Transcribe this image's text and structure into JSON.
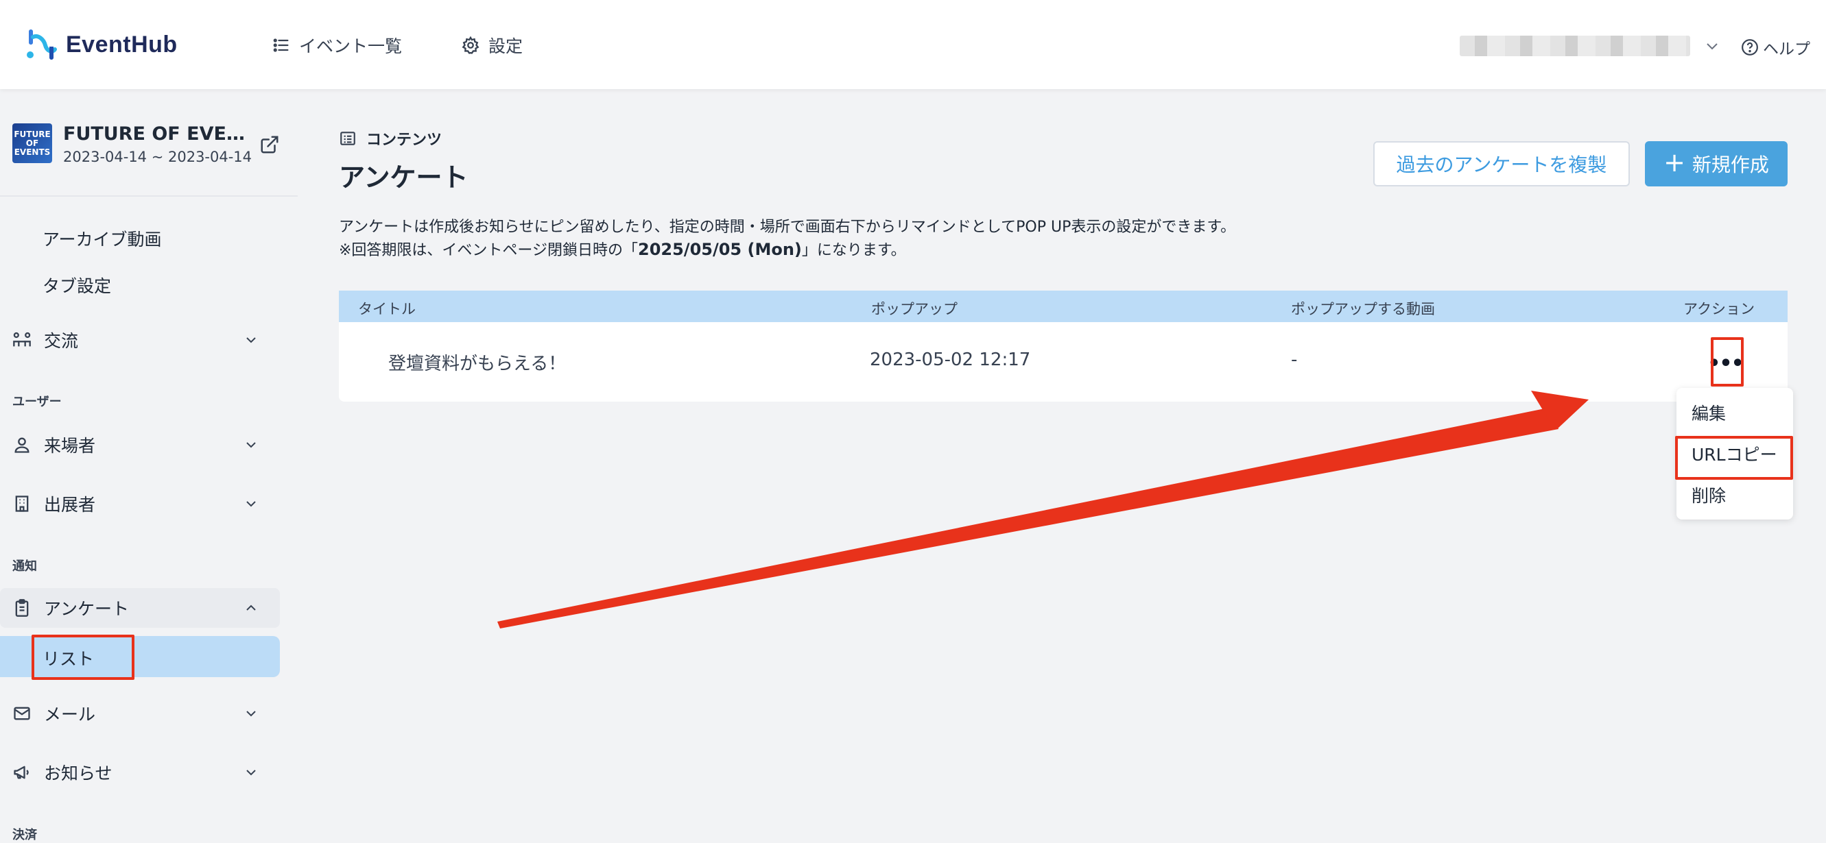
{
  "header": {
    "brand": "EventHub",
    "nav": [
      {
        "label": "イベント一覧",
        "icon": "list-icon"
      },
      {
        "label": "設定",
        "icon": "gear-icon"
      }
    ],
    "help_label": "ヘルプ"
  },
  "sidebar": {
    "event": {
      "thumb_text": "FUTURE OF EVENTS",
      "name": "FUTURE OF EVEN…",
      "dates": "2023-04-14 ~ 2023-04-14"
    },
    "sub_items": [
      "アーカイブ動画",
      "タブ設定"
    ],
    "items": {
      "exchange": "交流",
      "visitors": "来場者",
      "exhibitors": "出展者",
      "survey": "アンケート",
      "survey_list": "リスト",
      "mail": "メール",
      "notice": "お知らせ"
    },
    "groups": {
      "users": "ユーザー",
      "notify": "通知",
      "payment": "決済"
    }
  },
  "main": {
    "breadcrumb": "コンテンツ",
    "title": "アンケート",
    "duplicate_button": "過去のアンケートを複製",
    "new_button": "新規作成",
    "description_line1": "アンケートは作成後お知らせにピン留めしたり、指定の時間・場所で画面右下からリマインドとしてPOP UP表示の設定ができます。",
    "description_line2_prefix": "※回答期限は、イベントページ閉鎖日時の「",
    "description_deadline": "2025/05/05 (Mon)",
    "description_line2_suffix": "」になります。",
    "table": {
      "columns": [
        "タイトル",
        "ポップアップ",
        "ポップアップする動画",
        "アクション"
      ],
      "rows": [
        {
          "title": "登壇資料がもらえる！",
          "popup": "2023-05-02 12:17",
          "video": "-"
        }
      ]
    },
    "action_menu": [
      "編集",
      "URLコピー",
      "削除"
    ]
  },
  "colors": {
    "accent": "#4aa3de",
    "table_header": "#bcdcf7",
    "highlight": "#e8321b"
  }
}
